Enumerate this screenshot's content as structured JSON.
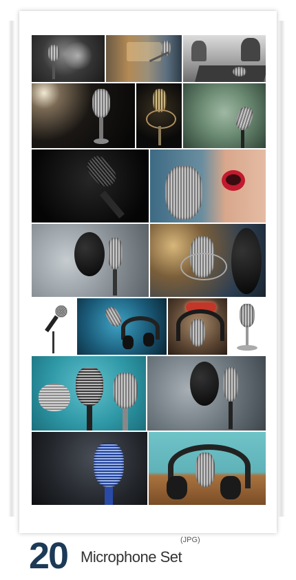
{
  "footer": {
    "count": "20",
    "title": "Microphone Set",
    "format": "(JPG)"
  },
  "tiles": [
    {
      "name": "tile-mic-dust-dark"
    },
    {
      "name": "tile-mic-studio-blur"
    },
    {
      "name": "tile-mic-mixer-bw"
    },
    {
      "name": "tile-vintage-mic-spotlight"
    },
    {
      "name": "tile-mic-gold-dark"
    },
    {
      "name": "tile-mic-green-texture"
    },
    {
      "name": "tile-mic-black-closeup"
    },
    {
      "name": "tile-woman-singing-mic"
    },
    {
      "name": "tile-condenser-pop-filter-grey"
    },
    {
      "name": "tile-condenser-pop-filter-bokeh"
    },
    {
      "name": "tile-handheld-mic-white"
    },
    {
      "name": "tile-mic-headphones-blue"
    },
    {
      "name": "tile-on-air-mic"
    },
    {
      "name": "tile-retro-mic-white"
    },
    {
      "name": "tile-three-retro-mics-teal"
    },
    {
      "name": "tile-condenser-pop-filter-slate"
    },
    {
      "name": "tile-blue-retro-mic"
    },
    {
      "name": "tile-mic-headphones-wood"
    }
  ]
}
